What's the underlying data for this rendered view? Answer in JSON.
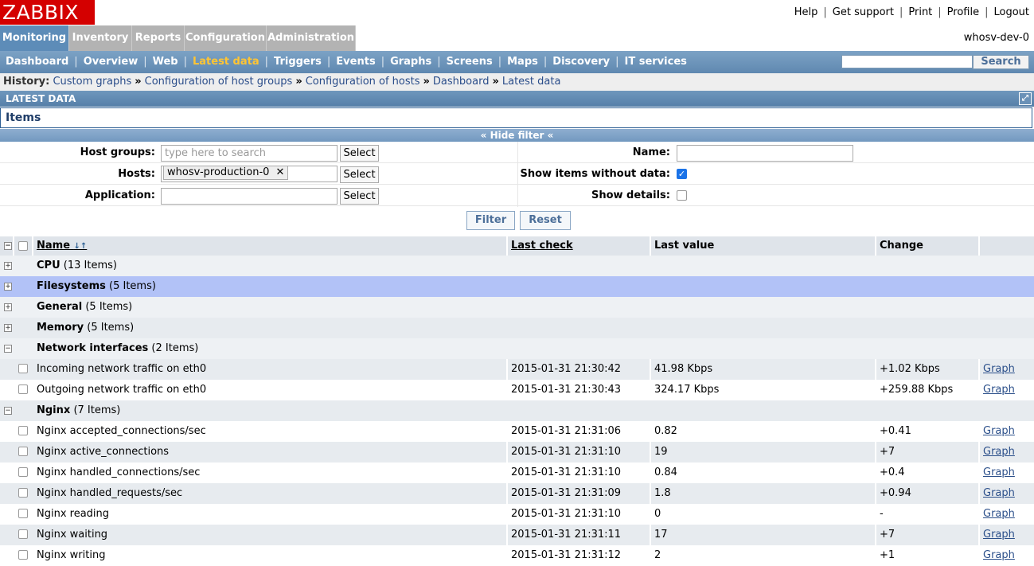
{
  "header": {
    "logo": "ZABBIX",
    "links": [
      "Help",
      "Get support",
      "Print",
      "Profile",
      "Logout"
    ]
  },
  "main_menu": {
    "items": [
      "Monitoring",
      "Inventory",
      "Reports",
      "Configuration",
      "Administration"
    ],
    "active": "Monitoring",
    "hostname": "whosv-dev-0"
  },
  "sub_menu": {
    "items": [
      "Dashboard",
      "Overview",
      "Web",
      "Latest data",
      "Triggers",
      "Events",
      "Graphs",
      "Screens",
      "Maps",
      "Discovery",
      "IT services"
    ],
    "active": "Latest data",
    "search_value": "",
    "search_label": "Search"
  },
  "history": {
    "label": "History:",
    "links": [
      "Custom graphs",
      "Configuration of host groups",
      "Configuration of hosts",
      "Dashboard",
      "Latest data"
    ]
  },
  "section": {
    "title": "LATEST DATA",
    "panel_title": "Items",
    "hide_filter": "Hide filter"
  },
  "filter": {
    "host_groups_label": "Host groups:",
    "host_groups_placeholder": "type here to search",
    "hosts_label": "Hosts:",
    "hosts_chip": "whosv-production-0",
    "application_label": "Application:",
    "application_value": "",
    "select_label": "Select",
    "name_label": "Name:",
    "name_value": "",
    "show_without_data_label": "Show items without data:",
    "show_without_data": true,
    "show_details_label": "Show details:",
    "show_details": false,
    "filter_button": "Filter",
    "reset_button": "Reset"
  },
  "table": {
    "columns": [
      "Name",
      "Last check",
      "Last value",
      "Change"
    ],
    "groups": [
      {
        "name": "CPU",
        "count": "(13 Items)",
        "expanded": false
      },
      {
        "name": "Filesystems",
        "count": "(5 Items)",
        "expanded": false
      },
      {
        "name": "General",
        "count": "(5 Items)",
        "expanded": false
      },
      {
        "name": "Memory",
        "count": "(5 Items)",
        "expanded": false
      },
      {
        "name": "Network interfaces",
        "count": "(2 Items)",
        "expanded": true
      },
      {
        "name": "Nginx",
        "count": "(7 Items)",
        "expanded": true
      }
    ],
    "network_rows": [
      {
        "name": "Incoming network traffic on eth0",
        "last_check": "2015-01-31 21:30:42",
        "last_value": "41.98 Kbps",
        "change": "+1.02 Kbps",
        "link": "Graph"
      },
      {
        "name": "Outgoing network traffic on eth0",
        "last_check": "2015-01-31 21:30:43",
        "last_value": "324.17 Kbps",
        "change": "+259.88 Kbps",
        "link": "Graph"
      }
    ],
    "nginx_rows": [
      {
        "name": "Nginx accepted_connections/sec",
        "last_check": "2015-01-31 21:31:06",
        "last_value": "0.82",
        "change": "+0.41",
        "link": "Graph"
      },
      {
        "name": "Nginx active_connections",
        "last_check": "2015-01-31 21:31:10",
        "last_value": "19",
        "change": "+7",
        "link": "Graph"
      },
      {
        "name": "Nginx handled_connections/sec",
        "last_check": "2015-01-31 21:31:10",
        "last_value": "0.84",
        "change": "+0.4",
        "link": "Graph"
      },
      {
        "name": "Nginx handled_requests/sec",
        "last_check": "2015-01-31 21:31:09",
        "last_value": "1.8",
        "change": "+0.94",
        "link": "Graph"
      },
      {
        "name": "Nginx reading",
        "last_check": "2015-01-31 21:31:10",
        "last_value": "0",
        "change": "-",
        "link": "Graph"
      },
      {
        "name": "Nginx waiting",
        "last_check": "2015-01-31 21:31:11",
        "last_value": "17",
        "change": "+7",
        "link": "Graph"
      },
      {
        "name": "Nginx writing",
        "last_check": "2015-01-31 21:31:12",
        "last_value": "2",
        "change": "+1",
        "link": "Graph"
      }
    ]
  }
}
